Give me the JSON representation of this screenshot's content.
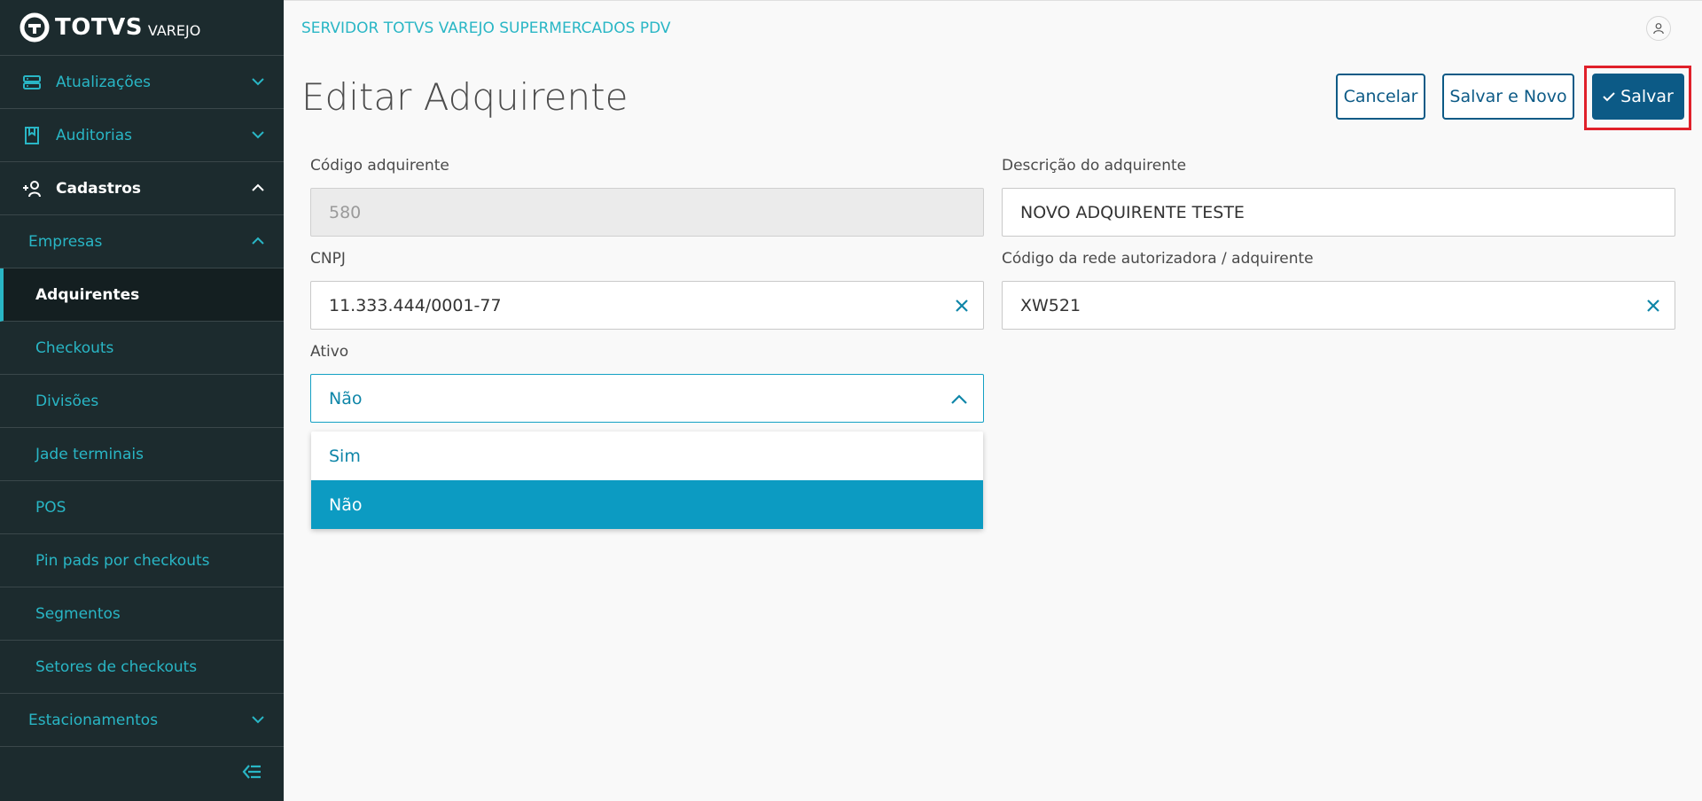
{
  "brand": {
    "name": "TOTVS",
    "sub": "VAREJO"
  },
  "sidebar": {
    "items": [
      {
        "label": "Atualizações"
      },
      {
        "label": "Auditorias"
      },
      {
        "label": "Cadastros"
      },
      {
        "label": "Empresas"
      },
      {
        "label": "Adquirentes"
      },
      {
        "label": "Checkouts"
      },
      {
        "label": "Divisões"
      },
      {
        "label": "Jade terminais"
      },
      {
        "label": "POS"
      },
      {
        "label": "Pin pads por checkouts"
      },
      {
        "label": "Segmentos"
      },
      {
        "label": "Setores de checkouts"
      },
      {
        "label": "Estacionamentos"
      }
    ]
  },
  "header": {
    "server_title": "SERVIDOR TOTVS VAREJO SUPERMERCADOS PDV"
  },
  "page": {
    "title": "Editar Adquirente",
    "buttons": {
      "cancel": "Cancelar",
      "save_new": "Salvar e Novo",
      "save": "Salvar"
    }
  },
  "form": {
    "codigo": {
      "label": "Código adquirente",
      "value": "580"
    },
    "descricao": {
      "label": "Descrição do adquirente",
      "value": "NOVO ADQUIRENTE TESTE"
    },
    "cnpj": {
      "label": "CNPJ",
      "value": "11.333.444/0001-77"
    },
    "rede": {
      "label": "Código da rede autorizadora / adquirente",
      "value": "XW521"
    },
    "ativo": {
      "label": "Ativo",
      "value": "Não",
      "options": [
        "Sim",
        "Não"
      ]
    }
  },
  "colors": {
    "sidebar_bg": "#1c2b2e",
    "accent": "#29b6c5",
    "primary": "#0c5a86",
    "highlight": "#e0202a",
    "option_selected": "#0c9bc2"
  },
  "icons": [
    "totvs-logo-icon",
    "updates-icon",
    "audit-icon",
    "add-user-icon",
    "chevron-down-icon",
    "chevron-up-icon",
    "collapse-menu-icon",
    "user-icon",
    "check-icon",
    "clear-icon"
  ]
}
